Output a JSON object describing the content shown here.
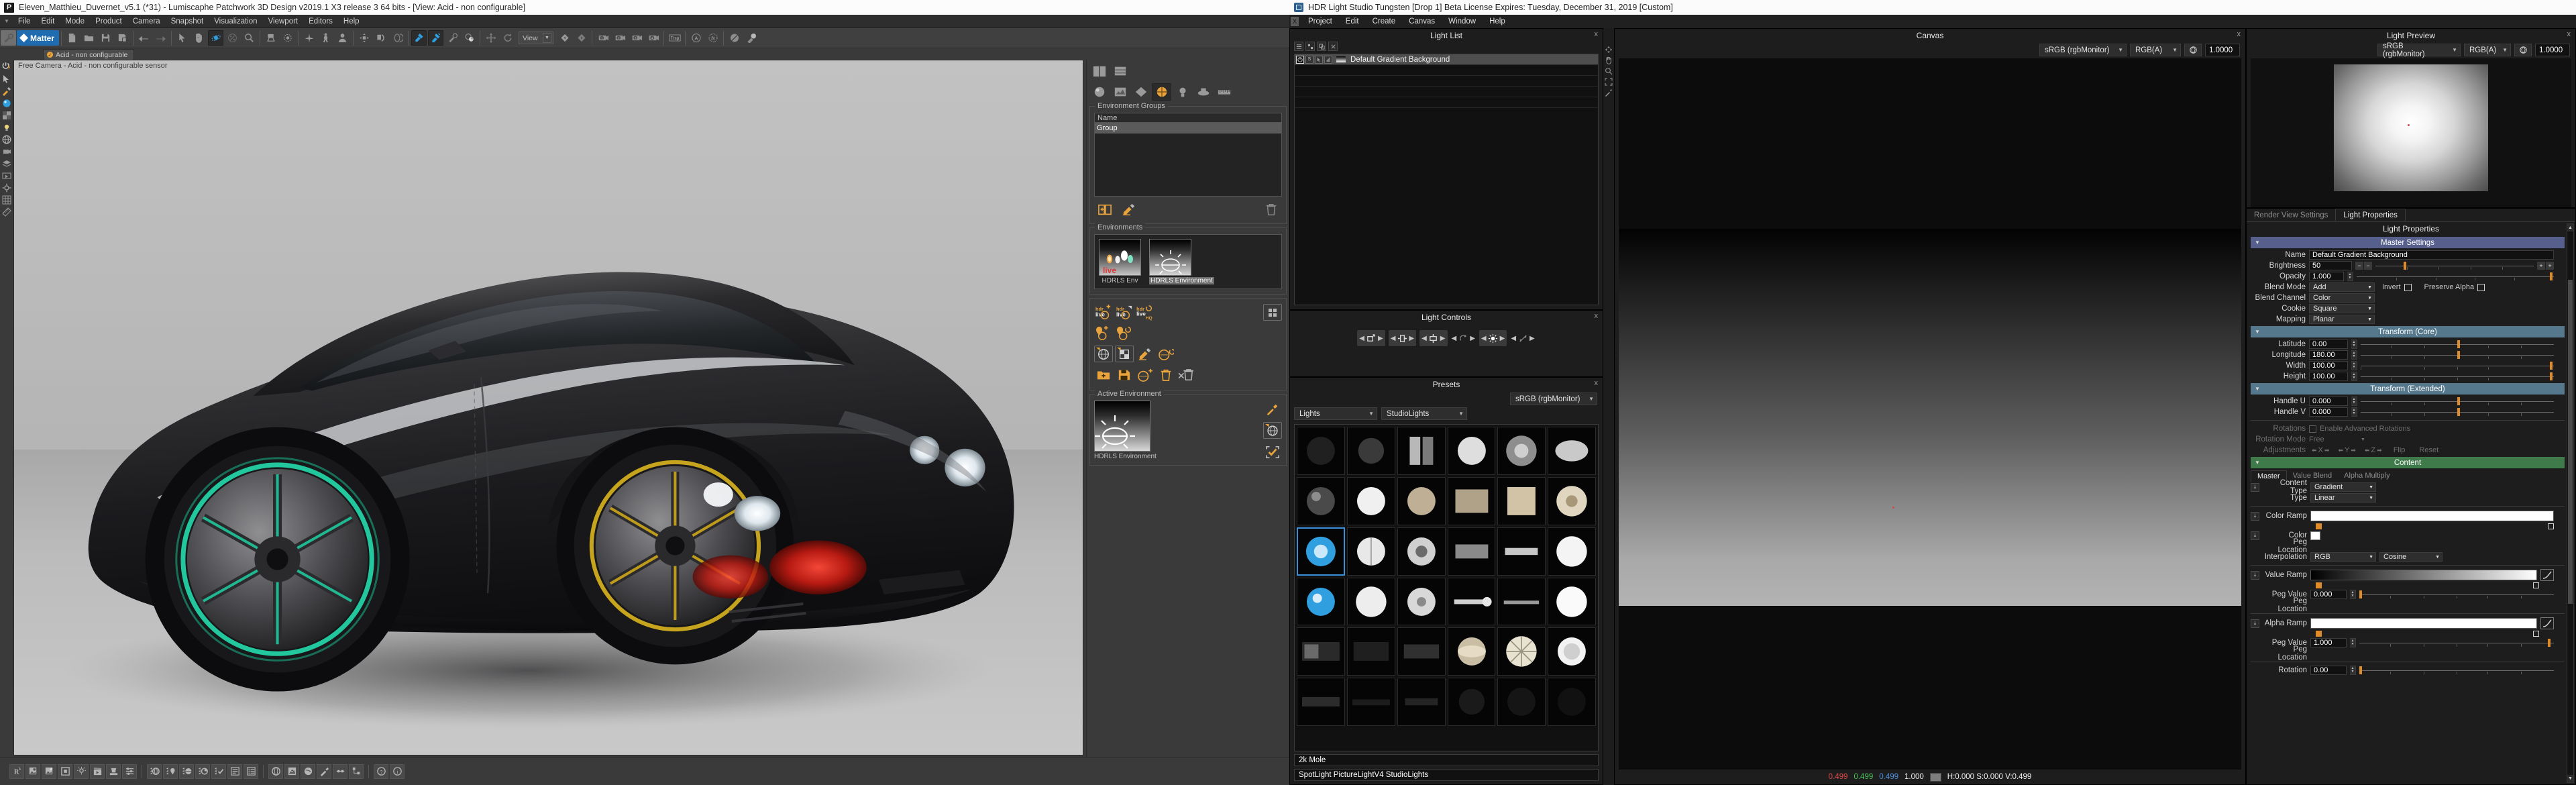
{
  "patchwork": {
    "title": "Eleven_Matthieu_Duvernet_v5.1 (*31) - Lumiscaphe Patchwork 3D Design v2019.1 X3 release 3  64 bits - [View: Acid - non configurable]",
    "menu": [
      "File",
      "Edit",
      "Mode",
      "Product",
      "Camera",
      "Snapshot",
      "Visualization",
      "Viewport",
      "Editors",
      "Help"
    ],
    "matter_label": "Matter",
    "view_selector": "View",
    "tab_label": "Acid - non configurable",
    "viewport_label": "Free Camera - Acid - non configurable sensor",
    "environment_groups": {
      "legend": "Environment Groups",
      "column_header": "Name",
      "rows": [
        "Group"
      ]
    },
    "environments": {
      "legend": "Environments",
      "items": [
        {
          "name": "HDRLS Env",
          "selected": false
        },
        {
          "name": "HDRLS Environment",
          "selected": true
        }
      ]
    },
    "active_environment": {
      "legend": "Active Environment",
      "name": "HDRLS Environment"
    }
  },
  "hdrls": {
    "title": "HDR Light Studio Tungsten [Drop 1] Beta License Expires: Tuesday, December 31, 2019  [Custom]",
    "menu": [
      "Project",
      "Edit",
      "Create",
      "Canvas",
      "Window",
      "Help"
    ],
    "light_list": {
      "title": "Light List",
      "close": "x",
      "rows": [
        {
          "name": "Default Gradient Background",
          "selected": true,
          "toggles": [
            "power-toggle",
            "solo-toggle",
            "select-toggle",
            "chart-toggle"
          ]
        }
      ]
    },
    "light_controls": {
      "title": "Light Controls",
      "close": "x"
    },
    "presets": {
      "title": "Presets",
      "close": "x",
      "colorspace": "sRGB (rgbMonitor)",
      "category": "Lights",
      "subcategory": "StudioLights",
      "name_field": "2k Mole",
      "path_field": "SpotLight PictureLightV4 StudioLights"
    },
    "canvas": {
      "title": "Canvas",
      "close": "x",
      "colorspace": "sRGB (rgbMonitor)",
      "channel": "RGB(A)",
      "exposure": "1.0000",
      "status": {
        "r": "0.499",
        "g": "0.499",
        "b": "0.499",
        "a": "1.000",
        "hsv": "H:0.000 S:0.000 V:0.499"
      }
    },
    "light_preview": {
      "title": "Light Preview",
      "close": "x",
      "colorspace": "sRGB (rgbMonitor)",
      "channel": "RGB(A)",
      "exposure": "1.0000"
    },
    "properties": {
      "tabs": [
        {
          "label": "Render View Settings",
          "active": false
        },
        {
          "label": "Light Properties",
          "active": true
        }
      ],
      "panel_title": "Light Properties",
      "close": "x",
      "master_settings": {
        "header": "Master Settings",
        "name_label": "Name",
        "name_value": "Default Gradient Background",
        "brightness_label": "Brightness",
        "brightness_value": "50",
        "opacity_label": "Opacity",
        "opacity_value": "1.000",
        "blend_mode_label": "Blend Mode",
        "blend_mode_value": "Add",
        "invert_label": "Invert",
        "invert_checked": false,
        "preserve_alpha_label": "Preserve Alpha",
        "preserve_alpha_checked": false,
        "blend_channel_label": "Blend Channel",
        "blend_channel_value": "Color",
        "cookie_label": "Cookie",
        "cookie_value": "Square",
        "mapping_label": "Mapping",
        "mapping_value": "Planar"
      },
      "transform_core": {
        "header": "Transform (Core)",
        "fields": [
          {
            "label": "Latitude",
            "value": "0.00",
            "handle_pct": 50
          },
          {
            "label": "Longitude",
            "value": "180.00",
            "handle_pct": 50
          },
          {
            "label": "Width",
            "value": "100.00",
            "handle_pct": 99
          },
          {
            "label": "Height",
            "value": "100.00",
            "handle_pct": 99
          }
        ]
      },
      "transform_extended": {
        "header": "Transform (Extended)",
        "fields": [
          {
            "label": "Handle U",
            "value": "0.000",
            "handle_pct": 50
          },
          {
            "label": "Handle V",
            "value": "0.000",
            "handle_pct": 50
          }
        ],
        "rotations_label": "Rotations",
        "enable_advanced_rotations_label": "Enable Advanced Rotations",
        "rotation_mode_label": "Rotation Mode",
        "rotation_mode_value": "Free",
        "adjustments_label": "Adjustments",
        "adjust_axes": [
          "X",
          "Y",
          "Z"
        ],
        "flip_label": "Flip",
        "reset_label": "Reset"
      },
      "content": {
        "header": "Content",
        "tabs": [
          {
            "label": "Master",
            "active": true
          },
          {
            "label": "Value Blend",
            "active": false
          },
          {
            "label": "Alpha Multiply",
            "active": false
          }
        ],
        "content_type_label": "Content Type",
        "content_type_value": "Gradient",
        "type_label": "Type",
        "type_value": "Linear",
        "color_ramp_label": "Color Ramp",
        "color_label": "Color",
        "color_value": "#ffffff",
        "peg_location_label": "Peg Location",
        "interpolation_label": "Interpolation",
        "interpolation_value": "RGB",
        "interpolation_curve": "Cosine",
        "value_ramp_label": "Value Ramp",
        "value_peg_value_label": "Peg Value",
        "value_peg_value": "0.000",
        "alpha_ramp_label": "Alpha Ramp",
        "alpha_peg_value_label": "Peg Value",
        "alpha_peg_value": "1.000",
        "rotation_label": "Rotation",
        "rotation_value": "0.00"
      }
    }
  }
}
